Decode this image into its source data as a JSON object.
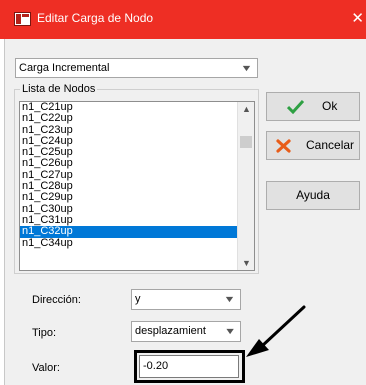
{
  "window": {
    "title": "Editar Carga de Nodo",
    "close_glyph": "✕",
    "icon": "app-window-icon"
  },
  "load_type": {
    "value": "Carga Incremental"
  },
  "node_list": {
    "label": "Lista de Nodos",
    "items": [
      "n1_C21up",
      "n1_C22up",
      "n1_C23up",
      "n1_C24up",
      "n1_C25up",
      "n1_C26up",
      "n1_C27up",
      "n1_C28up",
      "n1_C29up",
      "n1_C30up",
      "n1_C31up",
      "n1_C32up",
      "n1_C34up"
    ],
    "selected": "n1_C32up"
  },
  "buttons": {
    "ok": {
      "label": "Ok",
      "icon": "checkmark-icon",
      "color": "#2ea043"
    },
    "cancel": {
      "label": "Cancelar",
      "icon": "cross-icon",
      "color": "#e85d1a"
    },
    "help": {
      "label": "Ayuda"
    }
  },
  "fields": {
    "direccion": {
      "label": "Dirección:",
      "value": "y"
    },
    "tipo": {
      "label": "Tipo:",
      "value": "desplazamient"
    },
    "valor": {
      "label": "Valor:",
      "value": "-0.20"
    }
  },
  "colors": {
    "titlebar": "#ee2e24",
    "selection": "#0078d7"
  }
}
